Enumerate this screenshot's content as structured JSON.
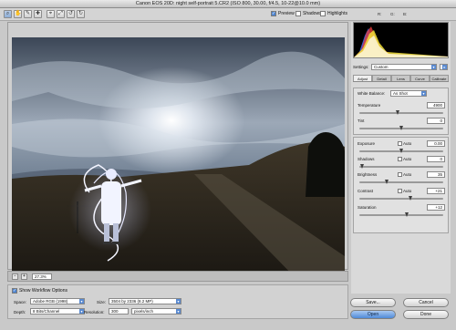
{
  "window": {
    "title": "Canon EOS 20D:  night self-portrait 5.CR2  (ISO 800, 30.00, f/4.5, 10-22@10.0 mm)"
  },
  "toolbar": {
    "tools": [
      {
        "name": "zoom-tool-icon",
        "glyph": "⌕"
      },
      {
        "name": "hand-tool-icon",
        "glyph": "✋"
      },
      {
        "name": "white-balance-tool-icon",
        "glyph": "✐"
      },
      {
        "name": "color-sampler-tool-icon",
        "glyph": "✚"
      },
      {
        "name": "crop-tool-icon",
        "glyph": "⌖"
      },
      {
        "name": "straighten-tool-icon",
        "glyph": "⤢"
      },
      {
        "name": "rotate-left-icon",
        "glyph": "↺"
      },
      {
        "name": "rotate-right-icon",
        "glyph": "↻"
      }
    ],
    "preview_label": "Preview",
    "shadows_label": "Shadows",
    "highlights_label": "Highlights",
    "rgb": {
      "r_label": "R:",
      "g_label": "G:",
      "b_label": "B:"
    }
  },
  "preview": {
    "zoom_value": "27.3%"
  },
  "workflow": {
    "show_label": "Show Workflow Options",
    "space_label": "Space:",
    "space_value": "Adobe RGB (1998)",
    "depth_label": "Depth:",
    "depth_value": "8 Bits/Channel",
    "size_label": "Size:",
    "size_value": "3504 by 2336 (8.2 MP)",
    "resolution_label": "Resolution:",
    "resolution_value": "300",
    "resolution_unit": "pixels/inch"
  },
  "panel": {
    "settings_label": "Settings:",
    "settings_value": "Custom",
    "tabs": [
      "Adjust",
      "Detail",
      "Lens",
      "Curve",
      "Calibrate"
    ],
    "white_balance_label": "White Balance:",
    "white_balance_value": "As Shot",
    "temperature": {
      "label": "Temperature",
      "value": "4900"
    },
    "tint": {
      "label": "Tint",
      "value": "0"
    },
    "exposure": {
      "label": "Exposure",
      "auto": "Auto",
      "value": "0.00"
    },
    "shadows": {
      "label": "Shadows",
      "auto": "Auto",
      "value": "0"
    },
    "brightness": {
      "label": "Brightness",
      "auto": "Auto",
      "value": "35"
    },
    "contrast": {
      "label": "Contrast",
      "auto": "Auto",
      "value": "+21"
    },
    "saturation": {
      "label": "Saturation",
      "value": "+12"
    }
  },
  "buttons": {
    "save": "Save...",
    "cancel": "Cancel",
    "open": "Open",
    "done": "Done"
  },
  "colors": {
    "accent": "#4f8ad8",
    "histogram_bg": "#000000"
  }
}
